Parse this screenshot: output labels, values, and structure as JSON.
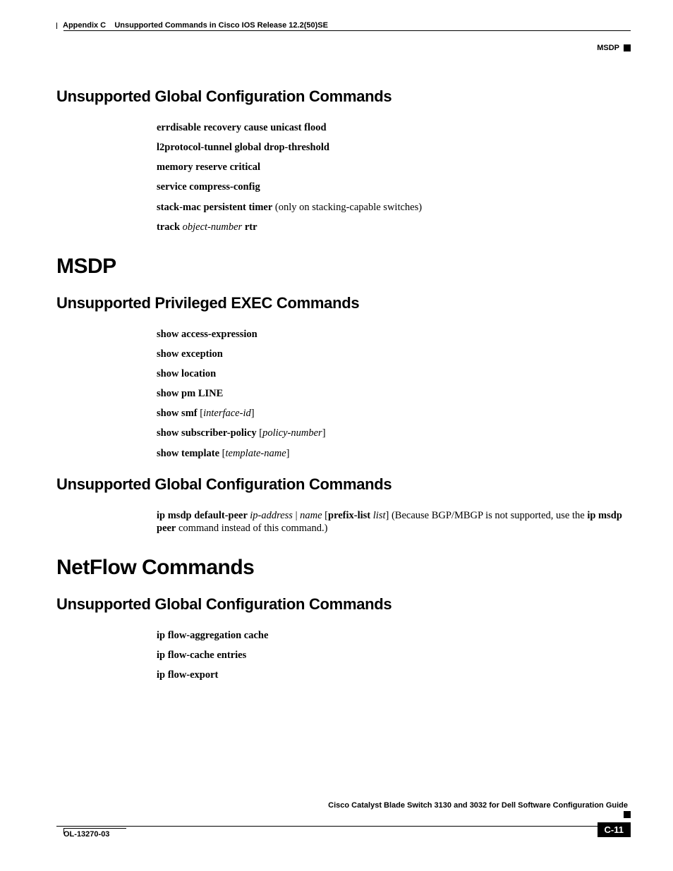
{
  "header": {
    "appendix": "Appendix C",
    "title": "Unsupported Commands in Cisco IOS Release 12.2(50)SE",
    "right_label": "MSDP"
  },
  "sections": {
    "s1": {
      "heading": "Unsupported Global Configuration Commands",
      "c1a": "errdisable recovery cause unicast flood",
      "c1b": "l2protocol-tunnel global drop-threshold",
      "c1c": "memory reserve critical",
      "c1d": "service compress-config",
      "c1e_b": "stack-mac persistent timer",
      "c1e_r": " (only on stacking-capable switches)",
      "c1f_b1": "track ",
      "c1f_i": "object-number",
      "c1f_b2": " rtr"
    },
    "s2": {
      "heading": "MSDP"
    },
    "s3": {
      "heading": "Unsupported Privileged EXEC Commands",
      "c3a": "show access-expression",
      "c3b": "show exception",
      "c3c": "show location",
      "c3d": "show pm LINE",
      "c3e_b": "show smf",
      "c3e_r1": " [",
      "c3e_i": "interface-id",
      "c3e_r2": "]",
      "c3f_b": "show subscriber-policy",
      "c3f_r1": " [",
      "c3f_i": "policy-number",
      "c3f_r2": "]",
      "c3g_b": "show template",
      "c3g_r1": " [",
      "c3g_i": "template-name",
      "c3g_r2": "]"
    },
    "s4": {
      "heading": "Unsupported Global Configuration Commands",
      "p1_b1": "ip msdp default-peer ",
      "p1_i1": "ip-address",
      "p1_r1": " | ",
      "p1_i2": "name",
      "p1_r2": " [",
      "p1_b2": "prefix-list",
      "p1_r3": " ",
      "p1_i3": "list",
      "p1_r4": "] (Because BGP/MBGP is not supported, use the ",
      "p1_b3": "ip msdp peer",
      "p1_r5": " command instead of this command.)"
    },
    "s5": {
      "heading": "NetFlow Commands"
    },
    "s6": {
      "heading": "Unsupported Global Configuration Commands",
      "c6a": "ip flow-aggregation cache",
      "c6b": "ip flow-cache entries",
      "c6c": "ip flow-export"
    }
  },
  "footer": {
    "book": "Cisco Catalyst Blade Switch 3130 and 3032 for Dell Software Configuration Guide",
    "docid": "OL-13270-03",
    "page": "C-11"
  }
}
